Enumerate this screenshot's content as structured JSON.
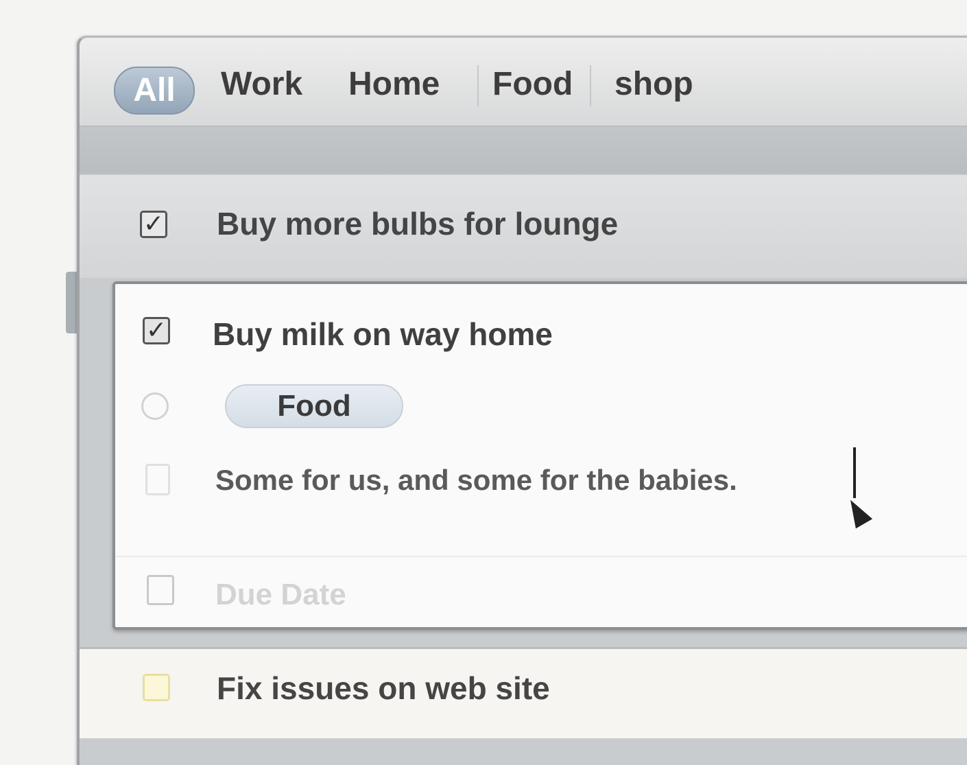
{
  "tabs": {
    "all": "All",
    "work": "Work",
    "home": "Home",
    "food": "Food",
    "shop": "shop"
  },
  "tasks": [
    {
      "title": "Buy more bulbs for lounge",
      "checked": true
    },
    {
      "title": "Fix issues on web site",
      "checked": false
    }
  ],
  "expanded_task": {
    "title": "Buy milk on way home",
    "checked": true,
    "tag": "Food",
    "note": "Some for us, and some for the babies.",
    "due_placeholder": "Due Date"
  }
}
